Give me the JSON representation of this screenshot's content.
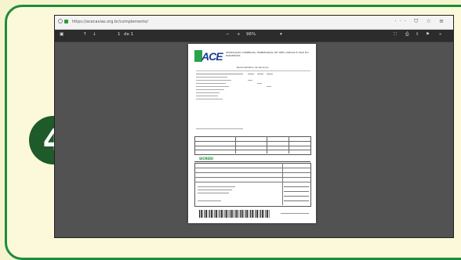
{
  "step": {
    "number": "4"
  },
  "browser": {
    "url": "https://acecaxias.org.br/complemento/",
    "actions": "··· ⛉ ☆ ≡"
  },
  "viewer": {
    "page_current": "1",
    "page_total": "de 1",
    "zoom": "96%",
    "zoom_out": "−",
    "zoom_in": "+"
  },
  "document": {
    "org_logo": "ACE",
    "org_header": "ASSOCIAÇÃO COMERCIAL, EMPRESARIAL DE TRÊS COROAS E VALE DO PARANHANA",
    "section_title": "Demonstrativo de Serviços",
    "bank_logo": "SICREDI"
  },
  "colors": {
    "frame": "#1e8c3a",
    "badge": "#1f5a2a",
    "viewer_bg": "#525252"
  }
}
